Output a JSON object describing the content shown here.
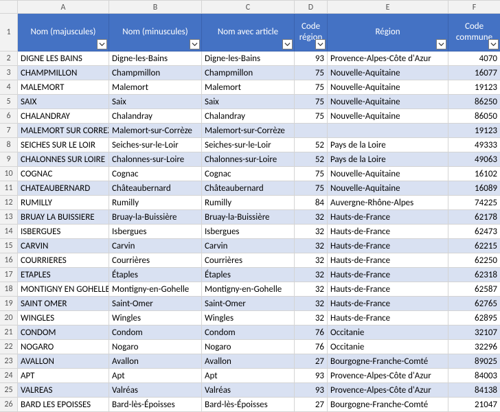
{
  "columns": [
    "A",
    "B",
    "C",
    "D",
    "E",
    "F"
  ],
  "headers": {
    "a": "Nom (majuscules)",
    "b": "Nom (minuscules)",
    "c": "Nom avec article",
    "d": "Code région",
    "e": "Région",
    "f": "Code commune"
  },
  "rows": [
    {
      "n": 2,
      "a": "DIGNE LES BAINS",
      "b": "Digne-les-Bains",
      "c": "Digne-les-Bains",
      "d": 93,
      "e": "Provence-Alpes-Côte d'Azur",
      "f": 4070
    },
    {
      "n": 3,
      "a": "CHAMPMILLON",
      "b": "Champmillon",
      "c": "Champmillon",
      "d": 75,
      "e": "Nouvelle-Aquitaine",
      "f": 16077
    },
    {
      "n": 4,
      "a": "MALEMORT",
      "b": "Malemort",
      "c": "Malemort",
      "d": 75,
      "e": "Nouvelle-Aquitaine",
      "f": 19123
    },
    {
      "n": 5,
      "a": "SAIX",
      "b": "Saix",
      "c": "Saix",
      "d": 75,
      "e": "Nouvelle-Aquitaine",
      "f": 86250
    },
    {
      "n": 6,
      "a": "CHALANDRAY",
      "b": "Chalandray",
      "c": "Chalandray",
      "d": 75,
      "e": "Nouvelle-Aquitaine",
      "f": 86050
    },
    {
      "n": 7,
      "a": "MALEMORT SUR CORREZE",
      "b": "Malemort-sur-Corrèze",
      "c": "Malemort-sur-Corrèze",
      "d": "",
      "e": "",
      "f": 19123
    },
    {
      "n": 8,
      "a": "SEICHES SUR LE LOIR",
      "b": "Seiches-sur-le-Loir",
      "c": "Seiches-sur-le-Loir",
      "d": 52,
      "e": "Pays de la Loire",
      "f": 49333
    },
    {
      "n": 9,
      "a": "CHALONNES SUR LOIRE",
      "b": "Chalonnes-sur-Loire",
      "c": "Chalonnes-sur-Loire",
      "d": 52,
      "e": "Pays de la Loire",
      "f": 49063
    },
    {
      "n": 10,
      "a": "COGNAC",
      "b": "Cognac",
      "c": "Cognac",
      "d": 75,
      "e": "Nouvelle-Aquitaine",
      "f": 16102
    },
    {
      "n": 11,
      "a": "CHATEAUBERNARD",
      "b": "Châteaubernard",
      "c": "Châteaubernard",
      "d": 75,
      "e": "Nouvelle-Aquitaine",
      "f": 16089
    },
    {
      "n": 12,
      "a": "RUMILLY",
      "b": "Rumilly",
      "c": "Rumilly",
      "d": 84,
      "e": "Auvergne-Rhône-Alpes",
      "f": 74225
    },
    {
      "n": 13,
      "a": "BRUAY LA BUISSIERE",
      "b": "Bruay-la-Buissière",
      "c": "Bruay-la-Buissière",
      "d": 32,
      "e": "Hauts-de-France",
      "f": 62178
    },
    {
      "n": 14,
      "a": "ISBERGUES",
      "b": "Isbergues",
      "c": "Isbergues",
      "d": 32,
      "e": "Hauts-de-France",
      "f": 62473
    },
    {
      "n": 15,
      "a": "CARVIN",
      "b": "Carvin",
      "c": "Carvin",
      "d": 32,
      "e": "Hauts-de-France",
      "f": 62215
    },
    {
      "n": 16,
      "a": "COURRIERES",
      "b": "Courrières",
      "c": "Courrières",
      "d": 32,
      "e": "Hauts-de-France",
      "f": 62250
    },
    {
      "n": 17,
      "a": "ETAPLES",
      "b": "Étaples",
      "c": "Étaples",
      "d": 32,
      "e": "Hauts-de-France",
      "f": 62318
    },
    {
      "n": 18,
      "a": "MONTIGNY EN GOHELLE",
      "b": "Montigny-en-Gohelle",
      "c": "Montigny-en-Gohelle",
      "d": 32,
      "e": "Hauts-de-France",
      "f": 62587
    },
    {
      "n": 19,
      "a": "SAINT OMER",
      "b": "Saint-Omer",
      "c": "Saint-Omer",
      "d": 32,
      "e": "Hauts-de-France",
      "f": 62765
    },
    {
      "n": 20,
      "a": "WINGLES",
      "b": "Wingles",
      "c": "Wingles",
      "d": 32,
      "e": "Hauts-de-France",
      "f": 62895
    },
    {
      "n": 21,
      "a": "CONDOM",
      "b": "Condom",
      "c": "Condom",
      "d": 76,
      "e": "Occitanie",
      "f": 32107
    },
    {
      "n": 22,
      "a": "NOGARO",
      "b": "Nogaro",
      "c": "Nogaro",
      "d": 76,
      "e": "Occitanie",
      "f": 32296
    },
    {
      "n": 23,
      "a": "AVALLON",
      "b": "Avallon",
      "c": "Avallon",
      "d": 27,
      "e": "Bourgogne-Franche-Comté",
      "f": 89025
    },
    {
      "n": 24,
      "a": "APT",
      "b": "Apt",
      "c": "Apt",
      "d": 93,
      "e": "Provence-Alpes-Côte d'Azur",
      "f": 84003
    },
    {
      "n": 25,
      "a": "VALREAS",
      "b": "Valréas",
      "c": "Valréas",
      "d": 93,
      "e": "Provence-Alpes-Côte d'Azur",
      "f": 84138
    },
    {
      "n": 26,
      "a": "BARD LES EPOISSES",
      "b": "Bard-lès-Époisses",
      "c": "Bard-lès-Époisses",
      "d": 27,
      "e": "Bourgogne-Franche-Comté",
      "f": 21047
    }
  ]
}
